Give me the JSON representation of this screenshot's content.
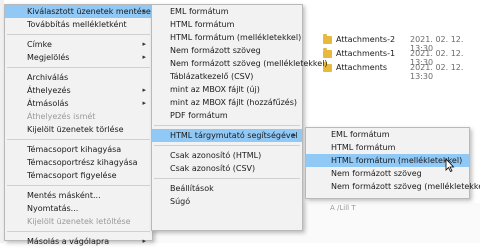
{
  "files": [
    {
      "name": "Attachments-2",
      "date": "2021. 02. 12. 13:30"
    },
    {
      "name": "Attachments-1",
      "date": "2021. 02. 12. 13:30"
    },
    {
      "name": "Attachments",
      "date": "2021. 02. 12. 13:30"
    }
  ],
  "bg_text": "A /Lill T",
  "menu1": [
    {
      "label": "Kiválasztott üzenetek mentése",
      "arrow": "▸",
      "hl": true
    },
    {
      "label": "Továbbítás mellékletként"
    },
    {
      "sep": true
    },
    {
      "label": "Címke",
      "arrow": "▸"
    },
    {
      "label": "Megjelölés",
      "arrow": "▸"
    },
    {
      "sep": true
    },
    {
      "label": "Archiválás"
    },
    {
      "label": "Áthelyezés",
      "arrow": "▸"
    },
    {
      "label": "Átmásolás",
      "arrow": "▸"
    },
    {
      "label": "Áthelyezés ismét",
      "dis": true
    },
    {
      "label": "Kijelölt üzenetek törlése"
    },
    {
      "sep": true
    },
    {
      "label": "Témacsoport kihagyása"
    },
    {
      "label": "Témacsoportrész kihagyása"
    },
    {
      "label": "Témacsoport figyelése"
    },
    {
      "sep": true
    },
    {
      "label": "Mentés másként..."
    },
    {
      "label": "Nyomtatás..."
    },
    {
      "label": "Kijelölt üzenetek letöltése",
      "dis": true
    },
    {
      "sep": true
    },
    {
      "label": "Másolás a vágólapra",
      "arrow": "▸"
    }
  ],
  "menu2": [
    {
      "label": "EML formátum"
    },
    {
      "label": "HTML formátum"
    },
    {
      "label": "HTML formátum (mellékletekkel)"
    },
    {
      "label": "Nem formázott szöveg"
    },
    {
      "label": "Nem formázott szöveg (mellékletekkel)"
    },
    {
      "label": "Táblázatkezelő (CSV)"
    },
    {
      "label": "mint az MBOX fájlt (új)"
    },
    {
      "label": "mint az MBOX fájlt (hozzáfűzés)"
    },
    {
      "label": "PDF formátum"
    },
    {
      "sep": true
    },
    {
      "label": "HTML tárgymutató segítségével",
      "arrow": "▸",
      "hl": true
    },
    {
      "sep": true
    },
    {
      "label": "Csak azonosító (HTML)"
    },
    {
      "label": "Csak azonosító (CSV)"
    },
    {
      "sep": true
    },
    {
      "label": "Beállítások"
    },
    {
      "label": "Súgó"
    }
  ],
  "menu3": [
    {
      "label": "EML formátum"
    },
    {
      "label": "HTML formátum"
    },
    {
      "label": "HTML formátum (mellékletekkel)",
      "hl": true
    },
    {
      "label": "Nem formázott szöveg"
    },
    {
      "label": "Nem formázott szöveg (mellékletekkel)"
    }
  ],
  "colors": {
    "highlight": "#90c8f6",
    "menu_bg": "#f2f2f2",
    "folder": "#e8b93c"
  }
}
